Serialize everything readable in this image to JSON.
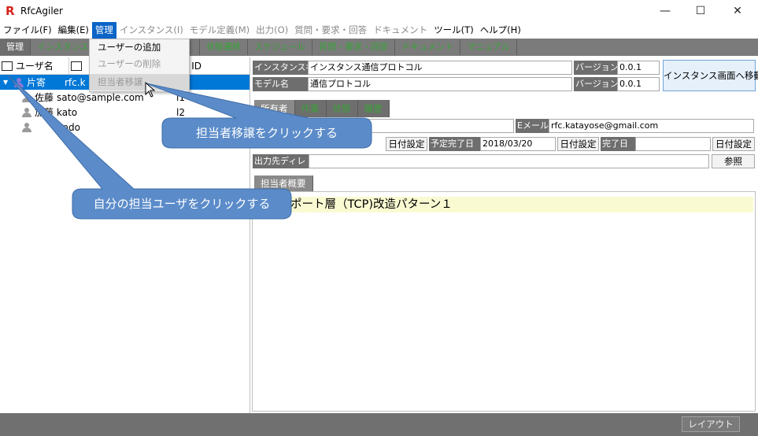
{
  "app": {
    "logo": "R",
    "title": "RfcAgiler",
    "window_controls": {
      "minimize": "—",
      "maximize": "☐",
      "close": "✕"
    }
  },
  "menubar": [
    {
      "label": "ファイル(F)",
      "state": "normal"
    },
    {
      "label": "編集(E)",
      "state": "normal"
    },
    {
      "label": "管理",
      "state": "active"
    },
    {
      "label": "インスタンス(I)",
      "state": "disabled"
    },
    {
      "label": "モデル定義(M)",
      "state": "disabled"
    },
    {
      "label": "出力(O)",
      "state": "disabled"
    },
    {
      "label": "質問・要求・回答",
      "state": "disabled"
    },
    {
      "label": "ドキュメント",
      "state": "disabled"
    },
    {
      "label": "ツール(T)",
      "state": "normal"
    },
    {
      "label": "ヘルプ(H)",
      "state": "normal"
    }
  ],
  "dropdown": [
    {
      "label": "ユーザーの追加",
      "state": "normal"
    },
    {
      "label": "ユーザーの削除",
      "state": "disabled"
    },
    {
      "label": "担当者移譲",
      "state": "hover"
    }
  ],
  "main_tabs": [
    "管理",
    "インスタンス",
    "",
    "",
    "状態遷移",
    "スケジュール",
    "質問・要求・回答",
    "ドキュメント",
    "マニュアル"
  ],
  "tree": {
    "headers": {
      "name": "ユーザ名",
      "mail": "",
      "id": "ID"
    },
    "rows": [
      {
        "expander": "▼",
        "name": "片寄",
        "mail": "rfc.k",
        "id": "",
        "selected": true,
        "icon": "blue"
      },
      {
        "expander": "",
        "name": "佐藤",
        "mail": "sato@sample.com",
        "id": "l1",
        "selected": false,
        "icon": "gray"
      },
      {
        "expander": "",
        "name": "加藤",
        "mail": "kato",
        "id": "l2",
        "selected": false,
        "icon": "gray"
      },
      {
        "expander": "",
        "name": "",
        "mail": "endo",
        "id": "",
        "selected": false,
        "icon": "gray"
      }
    ]
  },
  "details": {
    "instance_name_label": "インスタンス名",
    "instance_name_value": "インスタンス通信プロトコル",
    "version_label_1": "バージョン",
    "version_value_1": "0.0.1",
    "model_name_label": "モデル名",
    "model_name_value": "通信プロトコル",
    "version_label_2": "バージョン",
    "version_value_2": "0.0.1",
    "move_button": "インスタンス画面へ移動",
    "email_label": "Eメール",
    "email_value": "rfc.katayose@gmail.com",
    "date_set_button_1": "日付設定",
    "planned_done_label": "予定完了日",
    "planned_done_value": "2018/03/20",
    "date_set_button_2": "日付設定",
    "done_label": "完了日",
    "done_value": "",
    "date_set_button_3": "日付設定",
    "output_dir_label": "出力先ディレ",
    "output_dir_value": "",
    "browse_button": "参照",
    "summary_tab": "担当者概要",
    "summary_text": "ポート層（TCP)改造パターン１"
  },
  "sub_tabs": [
    "所有者",
    "作業",
    "状態",
    "履歴"
  ],
  "callouts": {
    "transfer": "担当者移譲をクリックする",
    "own_user": "自分の担当ユーザをクリックする"
  },
  "statusbar": {
    "layout_button": "レイアウト"
  },
  "colors": {
    "menu_active": "#0b64c6",
    "selection": "#0078d7",
    "callout_fill": "#5b8bc9",
    "tab_green": "#3aa23a"
  }
}
